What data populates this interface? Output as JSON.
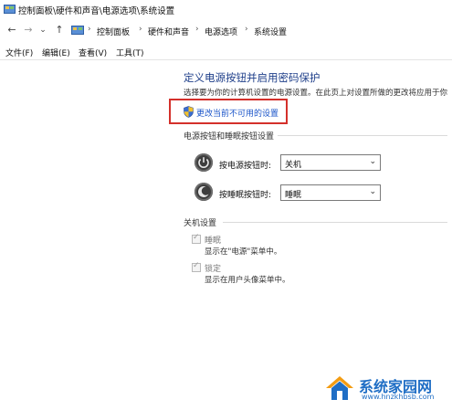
{
  "window": {
    "title": "控制面板\\硬件和声音\\电源选项\\系统设置"
  },
  "nav": {
    "back_glyph": "←",
    "forward_glyph": "→",
    "dropdown_glyph": "⌄",
    "up_glyph": "↑",
    "separator": "›",
    "breadcrumbs": [
      "控制面板",
      "硬件和声音",
      "电源选项",
      "系统设置"
    ]
  },
  "menu": {
    "items": [
      "文件(F)",
      "编辑(E)",
      "查看(V)",
      "工具(T)"
    ]
  },
  "main": {
    "title": "定义电源按钮并启用密码保护",
    "description": "选择要为你的计算机设置的电源设置。在此页上对设置所做的更改将应用于你",
    "change_link": "更改当前不可用的设置",
    "power_section": {
      "heading": "电源按钮和睡眠按钮设置",
      "rows": [
        {
          "label": "按电源按钮时:",
          "value": "关机",
          "icon": "power-icon"
        },
        {
          "label": "按睡眠按钮时:",
          "value": "睡眠",
          "icon": "sleep-icon"
        }
      ],
      "dropdown_arrow": "⌄"
    },
    "shutdown_section": {
      "heading": "关机设置",
      "options": [
        {
          "label": "睡眠",
          "checked": true,
          "enabled": false,
          "description": "显示在\"电源\"菜单中。"
        },
        {
          "label": "锁定",
          "checked": true,
          "enabled": false,
          "description": "显示在用户头像菜单中。"
        }
      ],
      "check_glyph": "✓"
    }
  },
  "watermark": {
    "text": "系统家园网",
    "url": "www.hnzkhbsb.com",
    "colors": {
      "primary": "#1f6ec5",
      "roof": "#f39c12"
    }
  },
  "colors": {
    "title": "#1f3f8a",
    "link": "#1b55c9",
    "highlight": "#d4302b"
  }
}
